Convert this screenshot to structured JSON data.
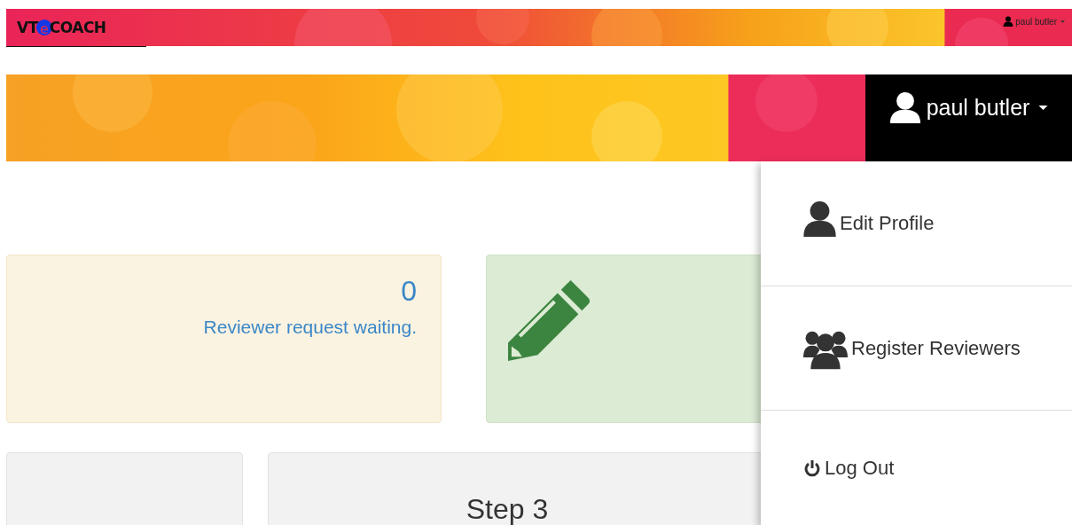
{
  "topbar": {
    "logo": {
      "prefix": "VT",
      "mark": "e",
      "suffix": "COACH"
    },
    "user": "paul butler"
  },
  "banner": {
    "user": "paul butler"
  },
  "user_menu": {
    "expanded": true,
    "items": [
      {
        "kind": "user",
        "label": "Edit Profile"
      },
      {
        "kind": "group",
        "label": "Register Reviewers"
      },
      {
        "kind": "power",
        "label": "Log Out"
      }
    ]
  },
  "stat_card": {
    "count": "0",
    "caption": "Reviewer request waiting."
  },
  "step_card": {
    "title": "Step 3"
  }
}
